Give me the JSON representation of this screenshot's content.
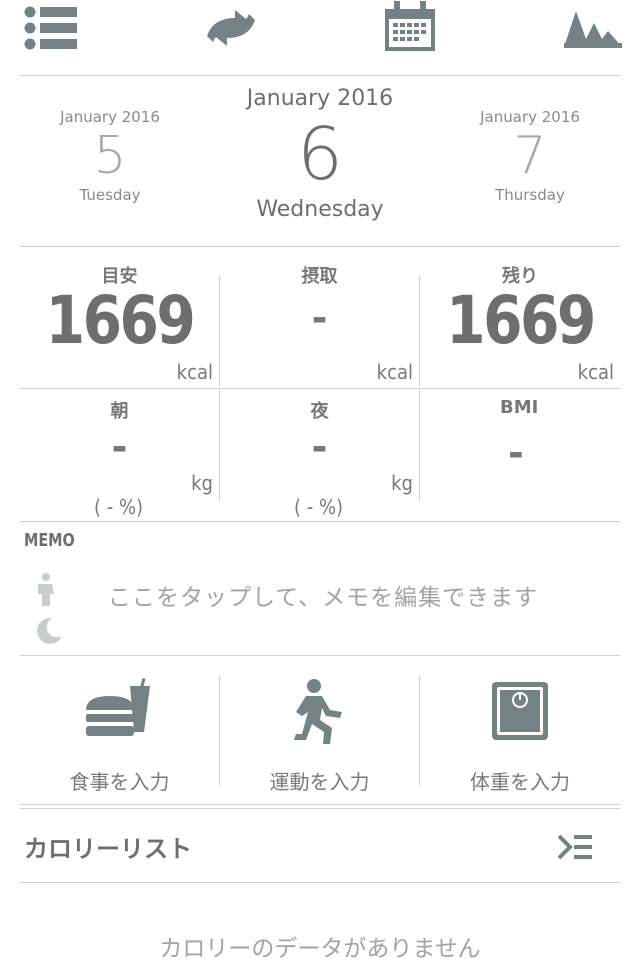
{
  "toolbar": {
    "menu_icon": "list-icon",
    "sync_icon": "sync-icon",
    "calendar_icon": "calendar-icon",
    "graph_icon": "graph-icon"
  },
  "date_nav": {
    "current_month": "January 2016",
    "current_day": "6",
    "current_weekday": "Wednesday",
    "prev": {
      "month": "January 2016",
      "day": "5",
      "weekday": "Tuesday"
    },
    "next": {
      "month": "January 2016",
      "day": "7",
      "weekday": "Thursday"
    }
  },
  "calories": {
    "target_label": "目安",
    "target_value": "1669",
    "intake_label": "摂取",
    "intake_value": "-",
    "remaining_label": "残り",
    "remaining_value": "1669",
    "unit": "kcal"
  },
  "weight": {
    "morning_label": "朝",
    "morning_value": "-",
    "morning_unit": "kg",
    "morning_pct": "( - %)",
    "night_label": "夜",
    "night_value": "-",
    "night_unit": "kg",
    "night_pct": "( - %)",
    "bmi_label": "BMI",
    "bmi_value": "-"
  },
  "memo": {
    "title": "MEMO",
    "placeholder": "ここをタップして、メモを編集できます"
  },
  "actions": {
    "meal": "食事を入力",
    "exercise": "運動を入力",
    "weight": "体重を入力"
  },
  "calorie_list": {
    "title": "カロリーリスト",
    "empty": "カロリーのデータがありません"
  },
  "colors": {
    "icon": "#758285",
    "text": "#8a8a8a",
    "divider": "#cfcfcf"
  }
}
